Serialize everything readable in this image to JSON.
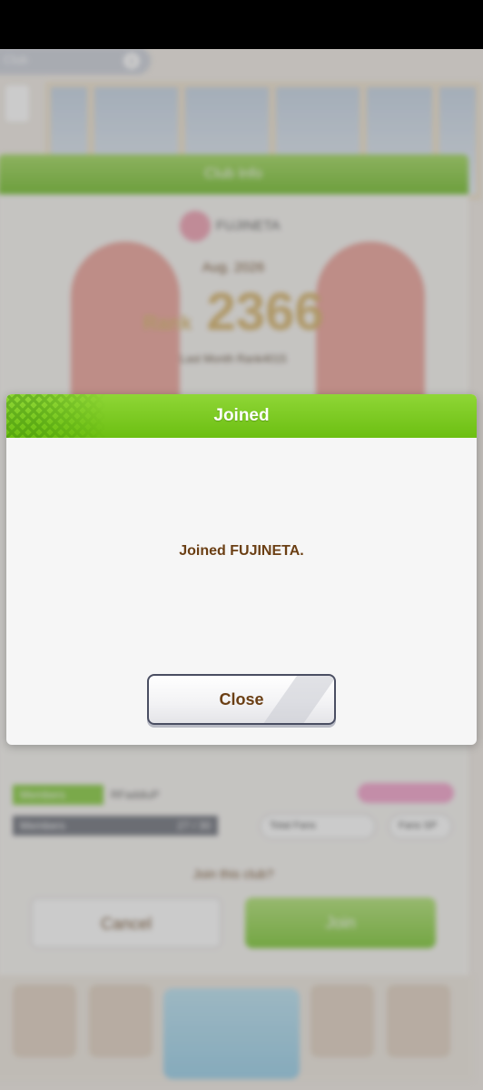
{
  "background": {
    "tab_label": "Club",
    "panel_title": "Club Info",
    "club_name": "FUJINETA",
    "month": "Aug. 2026",
    "rank_prefix": "Rank",
    "rank_value": "2366",
    "last_month": "Last Month Rank4015",
    "members_label": "Members",
    "members_row_text": "RFaddiuP",
    "members2_label": "Members",
    "members2_value": "27 / 30",
    "total_fans_label": "Total Fans",
    "fans_pill_right": "Fans SP",
    "join_question": "Join this club?",
    "cancel_label": "Cancel",
    "join_label": "Join"
  },
  "dialog": {
    "title": "Joined",
    "message": "Joined FUJINETA.",
    "close_label": "Close"
  },
  "colors": {
    "header_green": "#6cbf12",
    "text_brown": "#6b3f14",
    "button_border": "#4a4e62"
  }
}
